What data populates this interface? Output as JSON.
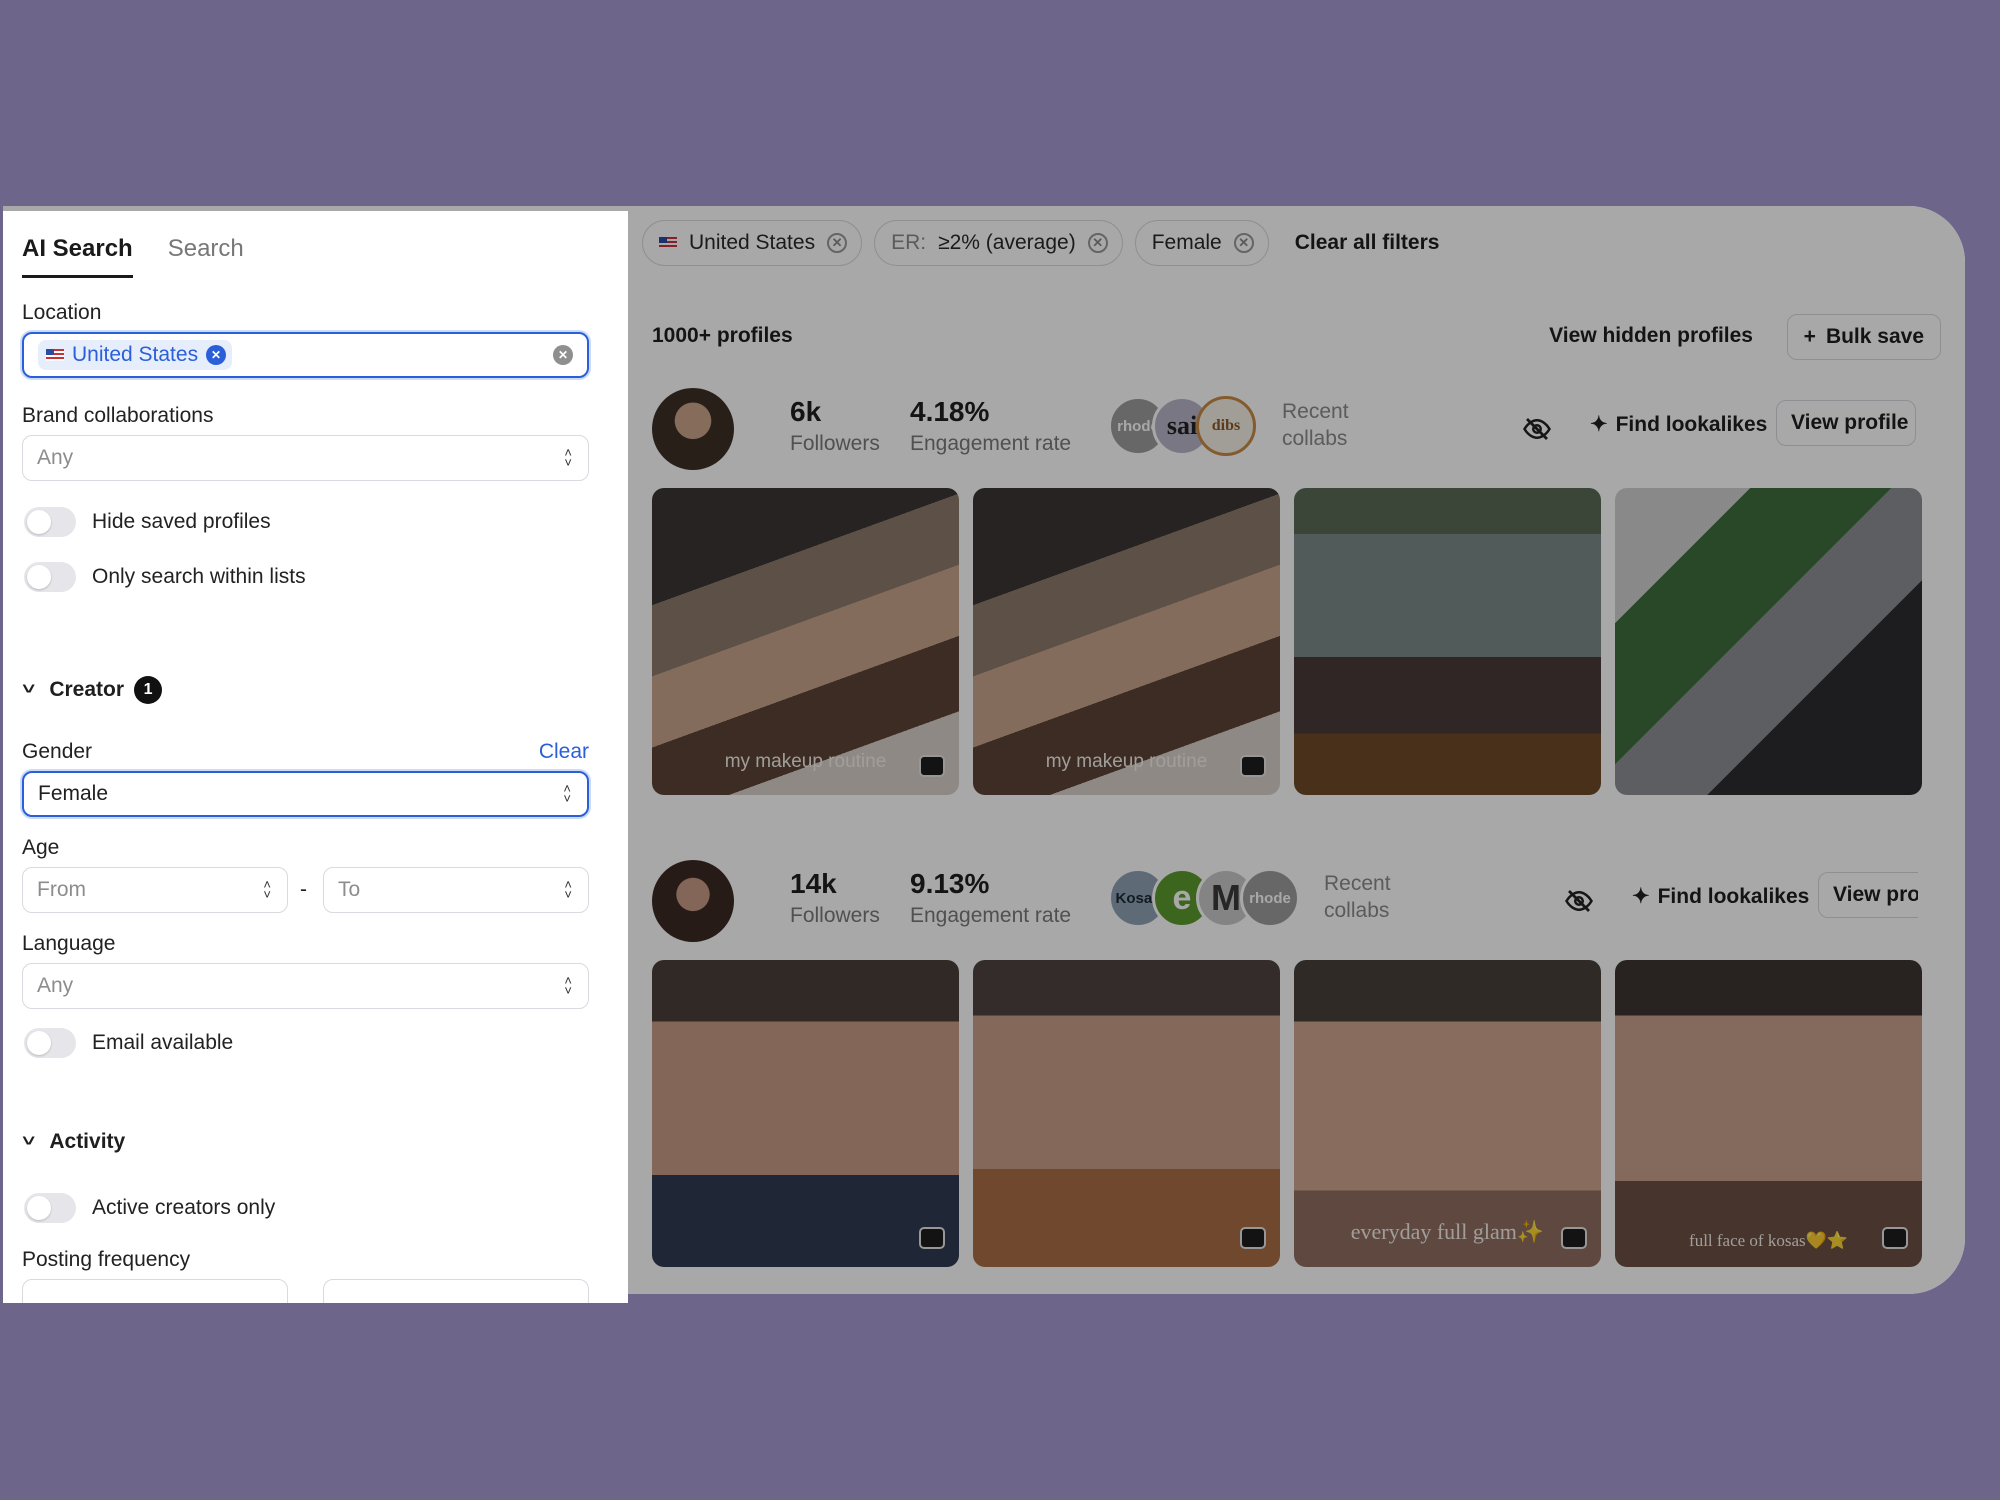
{
  "filters": {
    "chips": [
      {
        "label": "United States",
        "prefix": ""
      },
      {
        "label": "≥2% (average)",
        "prefix": "ER:"
      },
      {
        "label": "Female",
        "prefix": ""
      }
    ],
    "clear_all": "Clear all filters"
  },
  "results": {
    "count": "1000+ profiles",
    "hidden_link": "View hidden profiles",
    "bulk_save": "Bulk save",
    "profiles": [
      {
        "followers": "6k",
        "followers_label": "Followers",
        "er": "4.18%",
        "er_label": "Engagement rate",
        "collab_logos": [
          "rhode",
          "sai",
          "dibs"
        ],
        "recent_collabs": "Recent collabs",
        "find": "Find lookalikes",
        "view": "View profile",
        "captions": [
          "my makeup routine",
          "my makeup routine",
          "",
          ""
        ]
      },
      {
        "followers": "14k",
        "followers_label": "Followers",
        "er": "9.13%",
        "er_label": "Engagement rate",
        "collab_logos": [
          "Kosas",
          "e",
          "M",
          "rhode"
        ],
        "recent_collabs": "Recent collabs",
        "find": "Find lookalikes",
        "view": "View pro",
        "captions": [
          "",
          "",
          "everyday full glam✨",
          "full face of kosas💛⭐"
        ]
      }
    ]
  },
  "sidebar": {
    "tabs": [
      "AI Search",
      "Search"
    ],
    "location": {
      "label": "Location",
      "value": "United States"
    },
    "brand": {
      "label": "Brand collaborations",
      "placeholder": "Any"
    },
    "toggles": [
      "Hide saved profiles",
      "Only search within lists"
    ],
    "creator": {
      "title": "Creator",
      "badge": "1"
    },
    "gender": {
      "label": "Gender",
      "clear": "Clear",
      "value": "Female"
    },
    "age": {
      "label": "Age",
      "from": "From",
      "to": "To",
      "sep": "-"
    },
    "language": {
      "label": "Language",
      "placeholder": "Any"
    },
    "email": "Email available",
    "activity": {
      "title": "Activity"
    },
    "active": "Active creators only",
    "posting": {
      "label": "Posting frequency"
    }
  },
  "colors": {
    "accent": "#2b5fd9",
    "backdrop": "#6e658b"
  }
}
